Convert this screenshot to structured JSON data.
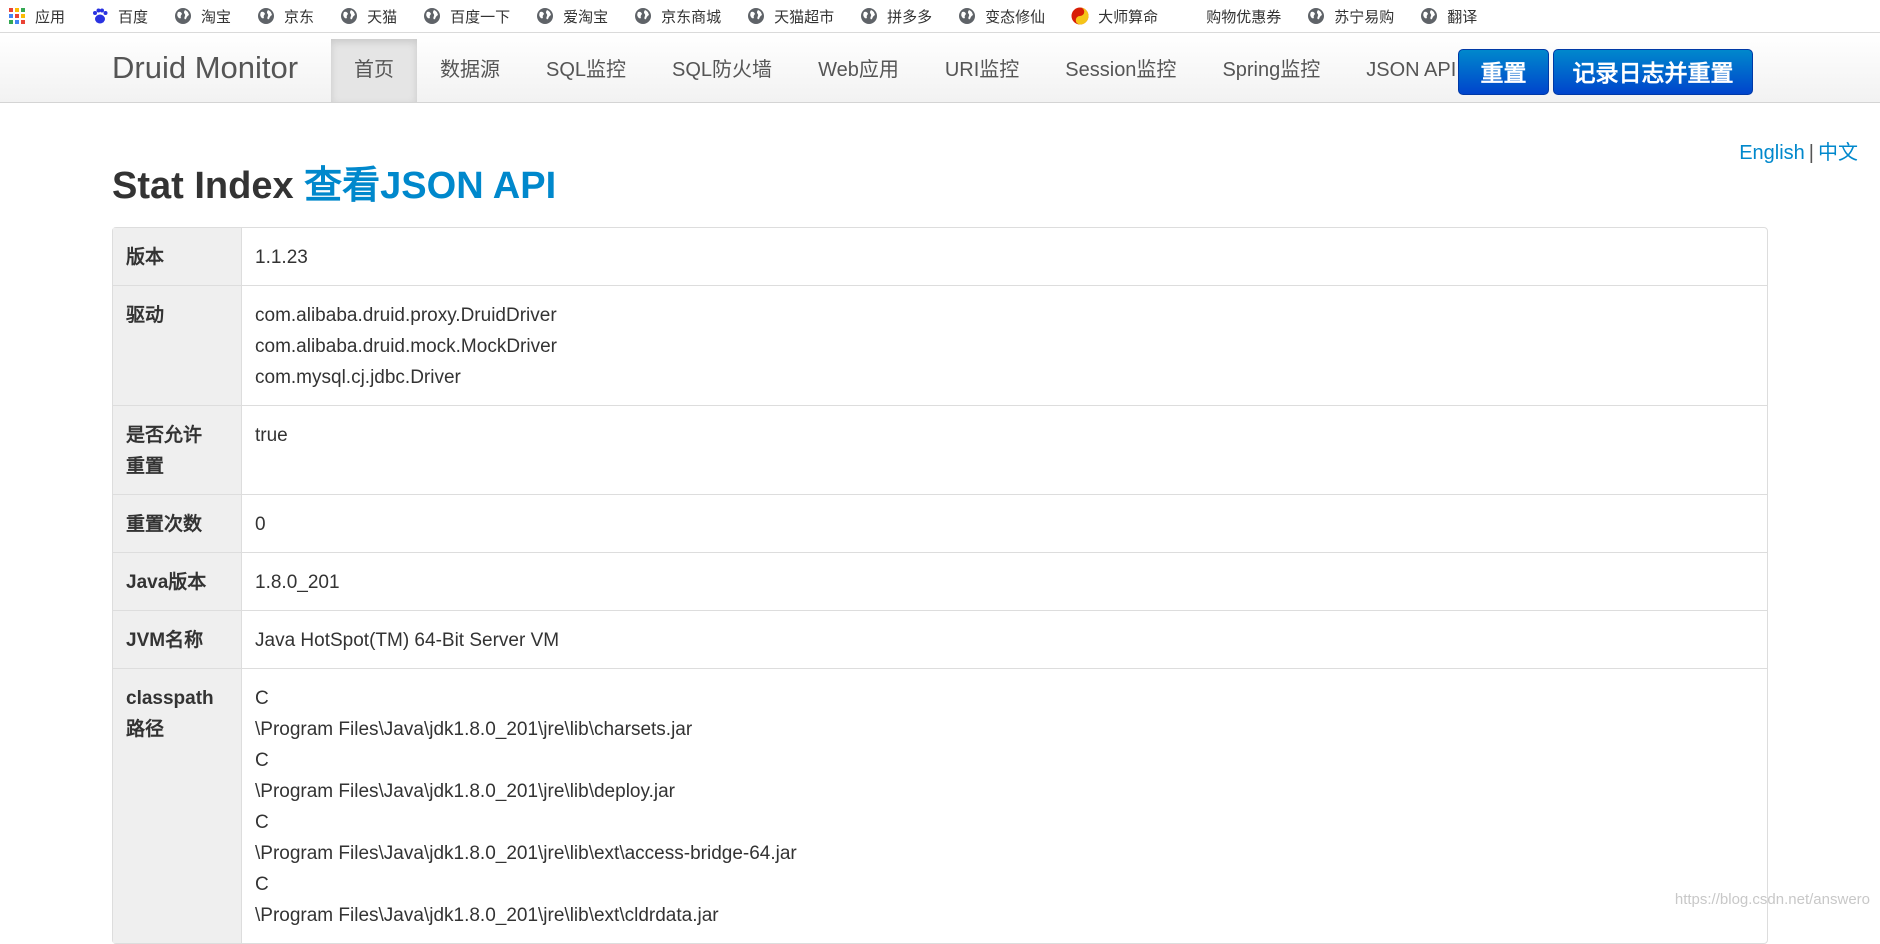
{
  "bookmarks": [
    {
      "label": "应用",
      "icon": "apps-grid-icon"
    },
    {
      "label": "百度",
      "icon": "baidu-paw-icon"
    },
    {
      "label": "淘宝",
      "icon": "globe-icon"
    },
    {
      "label": "京东",
      "icon": "globe-icon"
    },
    {
      "label": "天猫",
      "icon": "globe-icon"
    },
    {
      "label": "百度一下",
      "icon": "globe-icon"
    },
    {
      "label": "爱淘宝",
      "icon": "globe-icon"
    },
    {
      "label": "京东商城",
      "icon": "globe-icon"
    },
    {
      "label": "天猫超市",
      "icon": "globe-icon"
    },
    {
      "label": "拼多多",
      "icon": "globe-icon"
    },
    {
      "label": "变态修仙",
      "icon": "globe-icon"
    },
    {
      "label": "大师算命",
      "icon": "yin-yang-icon"
    },
    {
      "label": "购物优惠券",
      "icon": ""
    },
    {
      "label": "苏宁易购",
      "icon": "globe-icon"
    },
    {
      "label": "翻译",
      "icon": "globe-icon"
    }
  ],
  "navbar": {
    "brand": "Druid Monitor",
    "items": [
      {
        "label": "首页",
        "active": true
      },
      {
        "label": "数据源"
      },
      {
        "label": "SQL监控"
      },
      {
        "label": "SQL防火墙"
      },
      {
        "label": "Web应用"
      },
      {
        "label": "URI监控"
      },
      {
        "label": "Session监控"
      },
      {
        "label": "Spring监控"
      },
      {
        "label": "JSON API"
      }
    ],
    "reset_label": "重置",
    "log_reset_label": "记录日志并重置",
    "button_color": "#0055cc"
  },
  "lang": {
    "english": "English",
    "separator": "|",
    "chinese": "中文"
  },
  "title": {
    "text": "Stat Index",
    "link": "查看JSON API"
  },
  "table": {
    "rows": [
      {
        "label": "版本",
        "values": [
          "1.1.23"
        ]
      },
      {
        "label": "驱动",
        "values": [
          "com.alibaba.druid.proxy.DruidDriver",
          "com.alibaba.druid.mock.MockDriver",
          "com.mysql.cj.jdbc.Driver"
        ]
      },
      {
        "label": "是否允许\n重置",
        "values": [
          "true",
          ""
        ]
      },
      {
        "label": "重置次数",
        "values": [
          "0"
        ]
      },
      {
        "label": "Java版本",
        "values": [
          "1.8.0_201"
        ]
      },
      {
        "label": "JVM名称",
        "values": [
          "Java HotSpot(TM) 64-Bit Server VM"
        ]
      },
      {
        "label": "classpath\n路径",
        "values": [
          "C",
          "\\Program Files\\Java\\jdk1.8.0_201\\jre\\lib\\charsets.jar",
          "C",
          "\\Program Files\\Java\\jdk1.8.0_201\\jre\\lib\\deploy.jar",
          "C",
          "\\Program Files\\Java\\jdk1.8.0_201\\jre\\lib\\ext\\access-bridge-64.jar",
          "C",
          "\\Program Files\\Java\\jdk1.8.0_201\\jre\\lib\\ext\\cldrdata.jar"
        ]
      }
    ]
  },
  "watermark": "https://blog.csdn.net/answero"
}
